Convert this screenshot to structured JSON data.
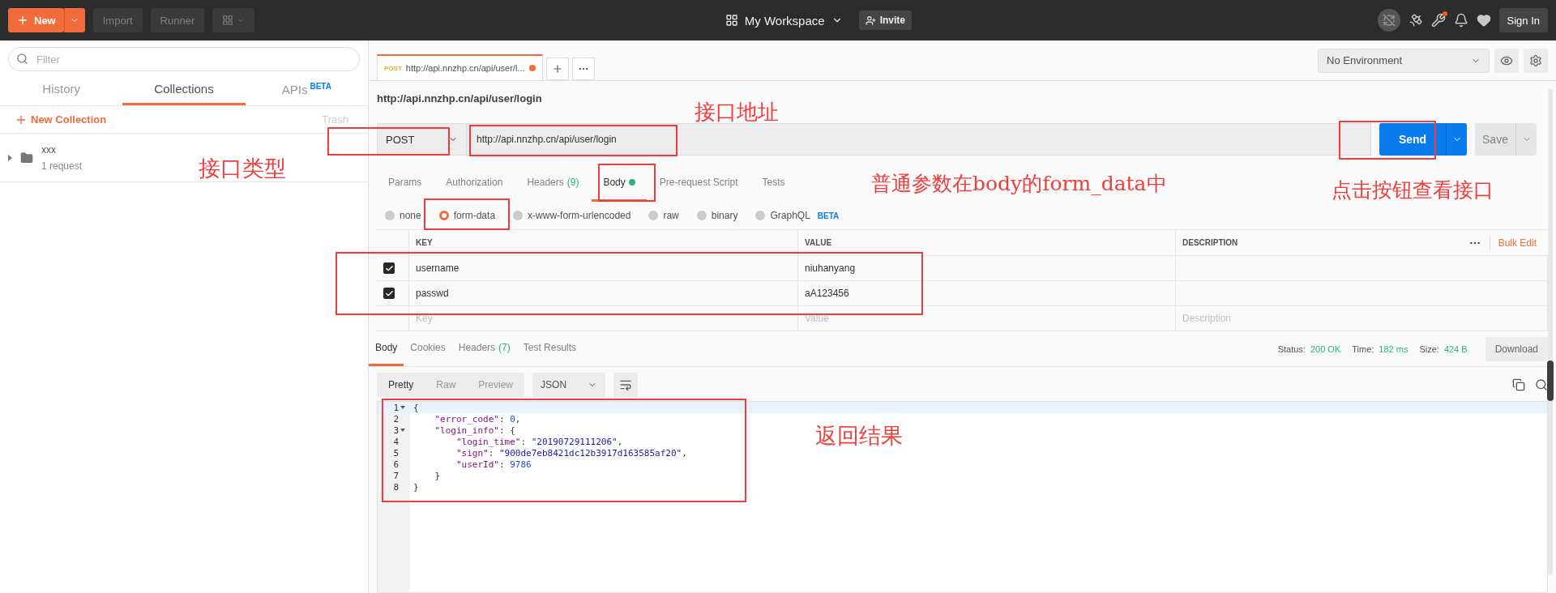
{
  "top_bar": {
    "new_button": "New",
    "buttons": [
      "Import",
      "Runner"
    ],
    "workspace": "My Workspace",
    "invite": "Invite",
    "sign_in": "Sign In"
  },
  "sidebar": {
    "filter_placeholder": "Filter",
    "tabs": [
      {
        "label": "History",
        "selected": false
      },
      {
        "label": "Collections",
        "selected": true
      },
      {
        "label": "APIs",
        "badge": "BETA",
        "selected": false
      }
    ],
    "new_collection": "New Collection",
    "trash": "Trash",
    "collections": [
      {
        "name": "xxx",
        "count": "1 request"
      }
    ]
  },
  "request_tabs": [
    {
      "method": "POST",
      "title": "http://api.nnzhp.cn/api/user/l...",
      "unsaved": true,
      "selected": true
    }
  ],
  "environment": "No Environment",
  "request_title": "http://api.nnzhp.cn/api/user/login",
  "request": {
    "method": "POST",
    "url": "http://api.nnzhp.cn/api/user/login",
    "send": "Send",
    "save": "Save"
  },
  "request_sections": [
    {
      "label": "Params",
      "selected": false
    },
    {
      "label": "Authorization",
      "selected": false
    },
    {
      "label": "Headers",
      "count": "(9)",
      "selected": false
    },
    {
      "label": "Body",
      "dot": true,
      "selected": true
    },
    {
      "label": "Pre-request Script",
      "selected": false
    },
    {
      "label": "Tests",
      "selected": false
    }
  ],
  "body_types": [
    {
      "label": "none",
      "selected": false
    },
    {
      "label": "form-data",
      "selected": true
    },
    {
      "label": "x-www-form-urlencoded",
      "selected": false
    },
    {
      "label": "raw",
      "selected": false
    },
    {
      "label": "binary",
      "selected": false
    },
    {
      "label": "GraphQL",
      "badge": "BETA",
      "selected": false
    }
  ],
  "params_table": {
    "columns": [
      "KEY",
      "VALUE",
      "DESCRIPTION"
    ],
    "bulk_edit": "Bulk Edit",
    "rows": [
      {
        "checked": true,
        "key": "username",
        "value": "niuhanyang"
      },
      {
        "checked": true,
        "key": "passwd",
        "value": "aA123456"
      }
    ],
    "new_row": [
      {
        "placeholder": "Key"
      },
      {
        "placeholder": "Value"
      },
      {
        "placeholder": "Description"
      }
    ]
  },
  "response": {
    "tabs": [
      {
        "label": "Body",
        "selected": true
      },
      {
        "label": "Cookies",
        "selected": false
      },
      {
        "label": "Headers",
        "count": "(7)",
        "selected": false
      },
      {
        "label": "Test Results",
        "selected": false
      }
    ],
    "status_label": "Status:",
    "status": "200 OK",
    "time_label": "Time:",
    "time": "182 ms",
    "size_label": "Size:",
    "size": "424 B",
    "download": "Download",
    "views": [
      {
        "label": "Pretty",
        "selected": true
      },
      {
        "label": "Raw",
        "selected": false
      },
      {
        "label": "Preview",
        "selected": false
      }
    ],
    "format": "JSON",
    "code": [
      {
        "number": "1",
        "foldable": true,
        "tokens": [
          {
            "kind": "punct",
            "text": "{"
          }
        ]
      },
      {
        "number": "2",
        "foldable": false,
        "tokens": [
          {
            "kind": "key",
            "text": "    \"error_code\""
          },
          {
            "kind": "punct",
            "text": ": "
          },
          {
            "kind": "number",
            "text": "0"
          },
          {
            "kind": "punct",
            "text": ","
          }
        ]
      },
      {
        "number": "3",
        "foldable": true,
        "tokens": [
          {
            "kind": "key",
            "text": "    \"login_info\""
          },
          {
            "kind": "punct",
            "text": ": {"
          }
        ]
      },
      {
        "number": "4",
        "foldable": false,
        "tokens": [
          {
            "kind": "key",
            "text": "        \"login_time\""
          },
          {
            "kind": "punct",
            "text": ": "
          },
          {
            "kind": "string",
            "text": "\"20190729111206\""
          },
          {
            "kind": "punct",
            "text": ","
          }
        ]
      },
      {
        "number": "5",
        "foldable": false,
        "tokens": [
          {
            "kind": "key",
            "text": "        \"sign\""
          },
          {
            "kind": "punct",
            "text": ": "
          },
          {
            "kind": "string",
            "text": "\"900de7eb8421dc12b3917d163585af20\""
          },
          {
            "kind": "punct",
            "text": ","
          }
        ]
      },
      {
        "number": "6",
        "foldable": false,
        "tokens": [
          {
            "kind": "key",
            "text": "        \"userId\""
          },
          {
            "kind": "punct",
            "text": ": "
          },
          {
            "kind": "number",
            "text": "9786"
          }
        ]
      },
      {
        "number": "7",
        "foldable": false,
        "tokens": [
          {
            "kind": "punct",
            "text": "    }"
          }
        ]
      },
      {
        "number": "8",
        "foldable": false,
        "tokens": [
          {
            "kind": "punct",
            "text": "}"
          }
        ]
      }
    ]
  },
  "annotations": [
    "接口类型",
    "接口地址",
    "普通参数在body的form_data中",
    "点击按钮查看接口",
    "返回结果"
  ]
}
